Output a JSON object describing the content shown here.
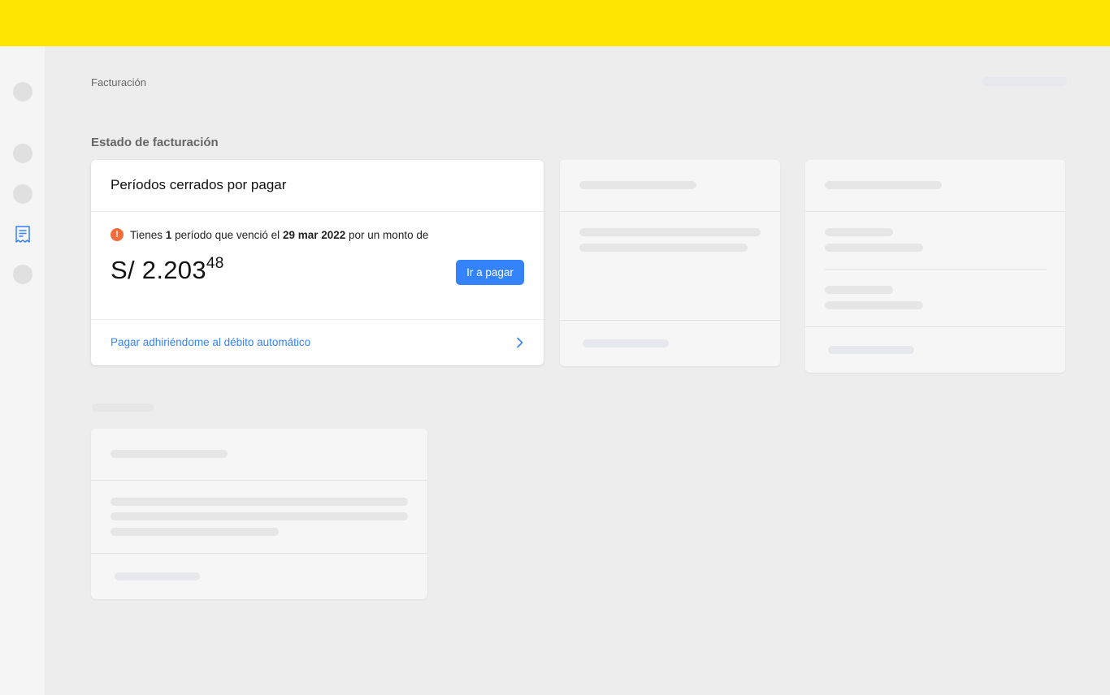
{
  "breadcrumb": "Facturación",
  "section_title": "Estado de facturación",
  "billing_card": {
    "title": "Períodos cerrados por pagar",
    "notice_prefix": "Tienes",
    "period_count": "1",
    "notice_mid": "período que venció el",
    "due_date": "29 mar 2022",
    "notice_suffix": "por un monto de",
    "amount_main": "S/ 2.203",
    "amount_cents": "48",
    "pay_button": "Ir a pagar",
    "autodebit_link": "Pagar adhiriéndome al débito automático"
  },
  "icons": {
    "warning": "warning-icon",
    "chevron": "chevron-right-icon",
    "billing": "receipt-icon"
  },
  "colors": {
    "topbar": "#ffe600",
    "accent": "#3483fa",
    "warning": "#f26c3c"
  }
}
